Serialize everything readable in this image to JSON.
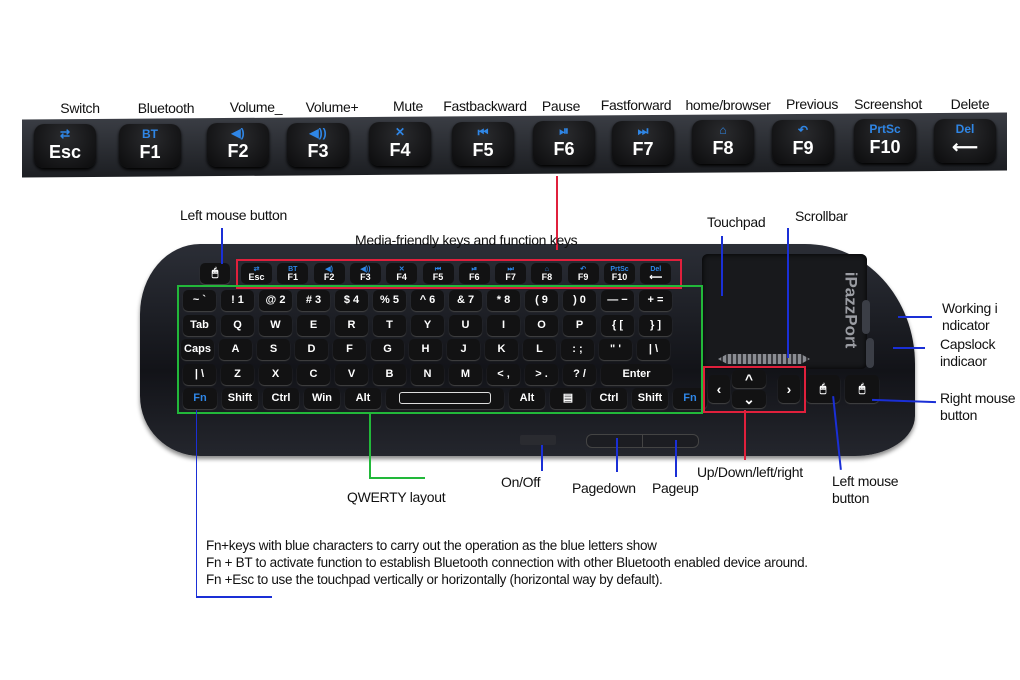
{
  "top_row": {
    "labels": [
      "Switch",
      "Bluetooth",
      "Volume_",
      "Volume+",
      "Mute",
      "Fastbackward",
      "Pause",
      "Fastforward",
      "home/browser",
      "Previous",
      "Screenshot",
      "Delete"
    ],
    "keys": [
      {
        "sub": "⇄",
        "main": "Esc"
      },
      {
        "sub": "BT",
        "main": "F1"
      },
      {
        "sub": "◀)",
        "main": "F2"
      },
      {
        "sub": "◀))",
        "main": "F3"
      },
      {
        "sub": "✕",
        "main": "F4"
      },
      {
        "sub": "⏮",
        "main": "F5"
      },
      {
        "sub": "⏯",
        "main": "F6"
      },
      {
        "sub": "⏭",
        "main": "F7"
      },
      {
        "sub": "⌂",
        "main": "F8"
      },
      {
        "sub": "↶",
        "main": "F9"
      },
      {
        "sub": "PrtSc",
        "main": "F10"
      },
      {
        "sub": "Del",
        "main": "⟵"
      }
    ]
  },
  "callouts": {
    "left_mouse_top": "Left mouse button",
    "media_keys": "Media-friendly keys and function keys",
    "touchpad": "Touchpad",
    "scrollbar": "Scrollbar",
    "working_indicator_1": "Working i",
    "working_indicator_2": "ndicator",
    "capslock_1": "Capslock",
    "capslock_2": "indicaor",
    "right_mouse_1": "Right mouse",
    "right_mouse_2": "button",
    "left_mouse_1": "Left mouse",
    "left_mouse_2": "button",
    "arrows": "Up/Down/left/right",
    "on_off": "On/Off",
    "pagedown": "Pagedown",
    "pageup": "Pageup",
    "qwerty": "QWERTY layout"
  },
  "brand": "iPazzPort",
  "keyboard": {
    "rows": [
      [
        "~ `",
        "! 1",
        "@ 2",
        "# 3",
        "$ 4",
        "% 5",
        "^ 6",
        "& 7",
        "* 8",
        "( 9",
        ") 0",
        "— −",
        "+ ="
      ],
      [
        "Tab",
        "Q",
        "W",
        "E",
        "R",
        "T",
        "Y",
        "U",
        "I",
        "O",
        "P",
        "{ [",
        "} ]"
      ],
      [
        "Caps",
        "A",
        "S",
        "D",
        "F",
        "G",
        "H",
        "J",
        "K",
        "L",
        ": ;",
        "\" '",
        "| \\"
      ],
      [
        "| \\",
        "Z",
        "X",
        "C",
        "V",
        "B",
        "N",
        "M",
        "< ,",
        "> .",
        "? /",
        "Enter"
      ],
      [
        "Fn",
        "Shift",
        "Ctrl",
        "Win",
        "Alt",
        "",
        "Alt",
        "▤",
        "Ctrl",
        "Shift",
        "Fn"
      ]
    ],
    "arrows": [
      "‹",
      "^",
      "⌄",
      "›"
    ]
  },
  "notes": [
    "Fn+keys with blue characters to carry out the operation as the blue letters show",
    "Fn + BT to activate function to establish Bluetooth connection with other Bluetooth enabled device around.",
    "Fn +Esc to  use the touchpad vertically or horizontally  (horizontal way by default)."
  ],
  "colors": {
    "media_box": "#e0203c",
    "qwerty_box": "#22b83a",
    "callout_line": "#1a2fd6",
    "fn_blue": "#2f86e6"
  }
}
